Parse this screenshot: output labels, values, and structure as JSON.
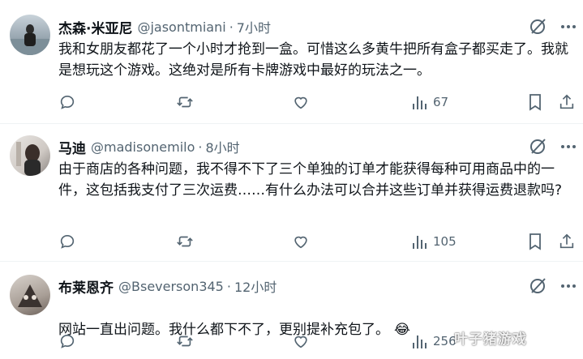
{
  "colors": {
    "text": "#0f1419",
    "secondary": "#536471",
    "divider": "#eff3f4"
  },
  "tweets": [
    {
      "name": "杰森·米亚尼",
      "handle": "@jasontmiani",
      "separator": "·",
      "time": "7小时",
      "text": "我和女朋友都花了一个小时才抢到一盒。可惜这么多黄牛把所有盒子都买走了。我就是想玩这个游戏。这绝对是所有卡牌游戏中最好的玩法之一。",
      "views": "67",
      "icons": [
        "grok-icon",
        "more-icon",
        "reply-icon",
        "retweet-icon",
        "like-icon",
        "views-icon",
        "bookmark-icon",
        "share-icon"
      ]
    },
    {
      "name": "马迪",
      "handle": "@madisonemilo",
      "separator": "·",
      "time": "8小时",
      "text": "由于商店的各种问题，我不得不下了三个单独的订单才能获得每种可用商品中的一件，这包括我支付了三次运费……有什么办法可以合并这些订单并获得运费退款吗?",
      "views": "105",
      "icons": [
        "grok-icon",
        "more-icon",
        "reply-icon",
        "retweet-icon",
        "like-icon",
        "views-icon",
        "bookmark-icon",
        "share-icon"
      ]
    },
    {
      "name": "布莱恩齐",
      "handle": "@Bseverson345",
      "separator": "·",
      "time": "12小时",
      "text": "网站一直出问题。我什么都下不了，更别提补充包了。",
      "emoji": "😂",
      "views": "256",
      "icons": [
        "grok-icon",
        "more-icon",
        "reply-icon",
        "retweet-icon",
        "like-icon",
        "views-icon"
      ]
    }
  ],
  "watermark": "叶子猪游戏"
}
